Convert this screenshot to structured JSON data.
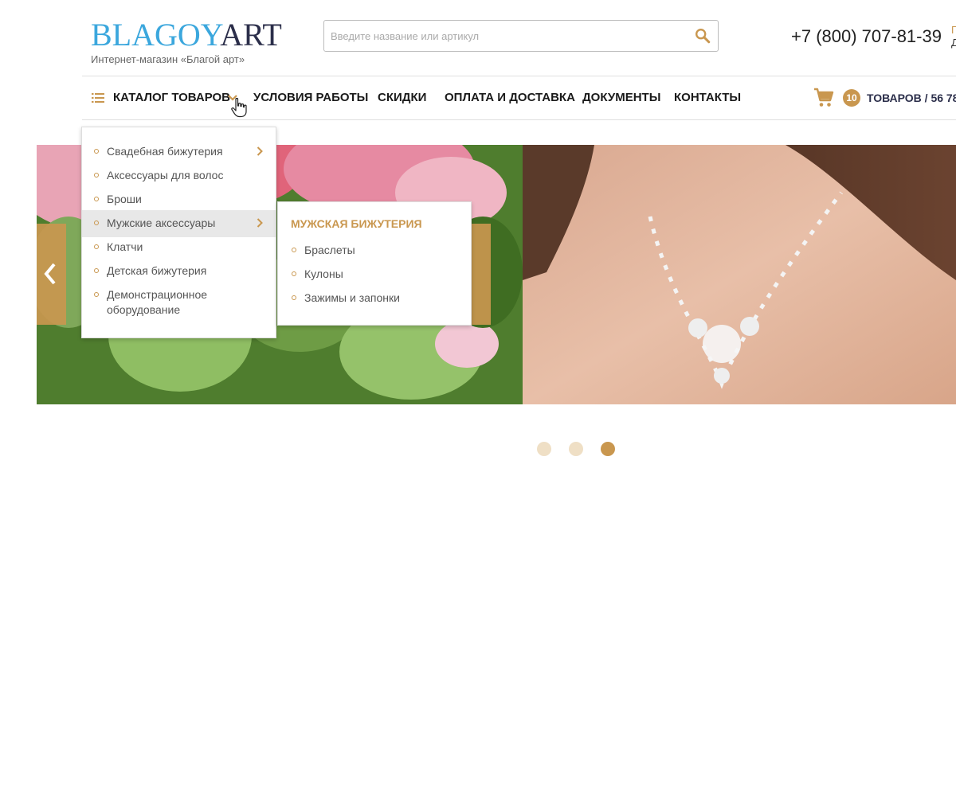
{
  "brand": {
    "logo_part1": "BLAGOY",
    "logo_part2": "ART",
    "subtitle": "Интернет-магазин «Благой арт»"
  },
  "search": {
    "placeholder": "Введите название или артикул",
    "value": ""
  },
  "contacts": {
    "phone": "+7 (800) 707-81-39",
    "side_line1": "П",
    "side_line2": "Д"
  },
  "nav": {
    "catalog_label": "КАТАЛОГ ТОВАРОВ",
    "items": [
      {
        "label": "УСЛОВИЯ РАБОТЫ"
      },
      {
        "label": "СКИДКИ"
      },
      {
        "label": "ОПЛАТА И ДОСТАВКА"
      },
      {
        "label": "ДОКУМЕНТЫ"
      },
      {
        "label": "КОНТАКТЫ"
      }
    ]
  },
  "cart": {
    "count": "10",
    "text": "ТОВАРОВ / 56 78"
  },
  "catalog_menu": {
    "items": [
      {
        "label": "Свадебная бижутерия"
      },
      {
        "label": "Аксессуары для волос"
      },
      {
        "label": "Броши"
      },
      {
        "label": "Мужские аксессуары"
      },
      {
        "label": "Клатчи"
      },
      {
        "label": "Детская бижутерия"
      },
      {
        "label": "Демонстрационное",
        "label2": "оборудование"
      }
    ]
  },
  "submenu": {
    "title": "МУЖСКАЯ БИЖУТЕРИЯ",
    "items": [
      {
        "label": "Браслеты"
      },
      {
        "label": "Кулоны"
      },
      {
        "label": "Зажимы и запонки"
      }
    ]
  },
  "slider": {
    "slides_total": 3,
    "active_slide": 3
  },
  "colors": {
    "accent": "#c9974f",
    "logo_blue": "#3ba7dd",
    "logo_dark": "#2b2e4a"
  }
}
